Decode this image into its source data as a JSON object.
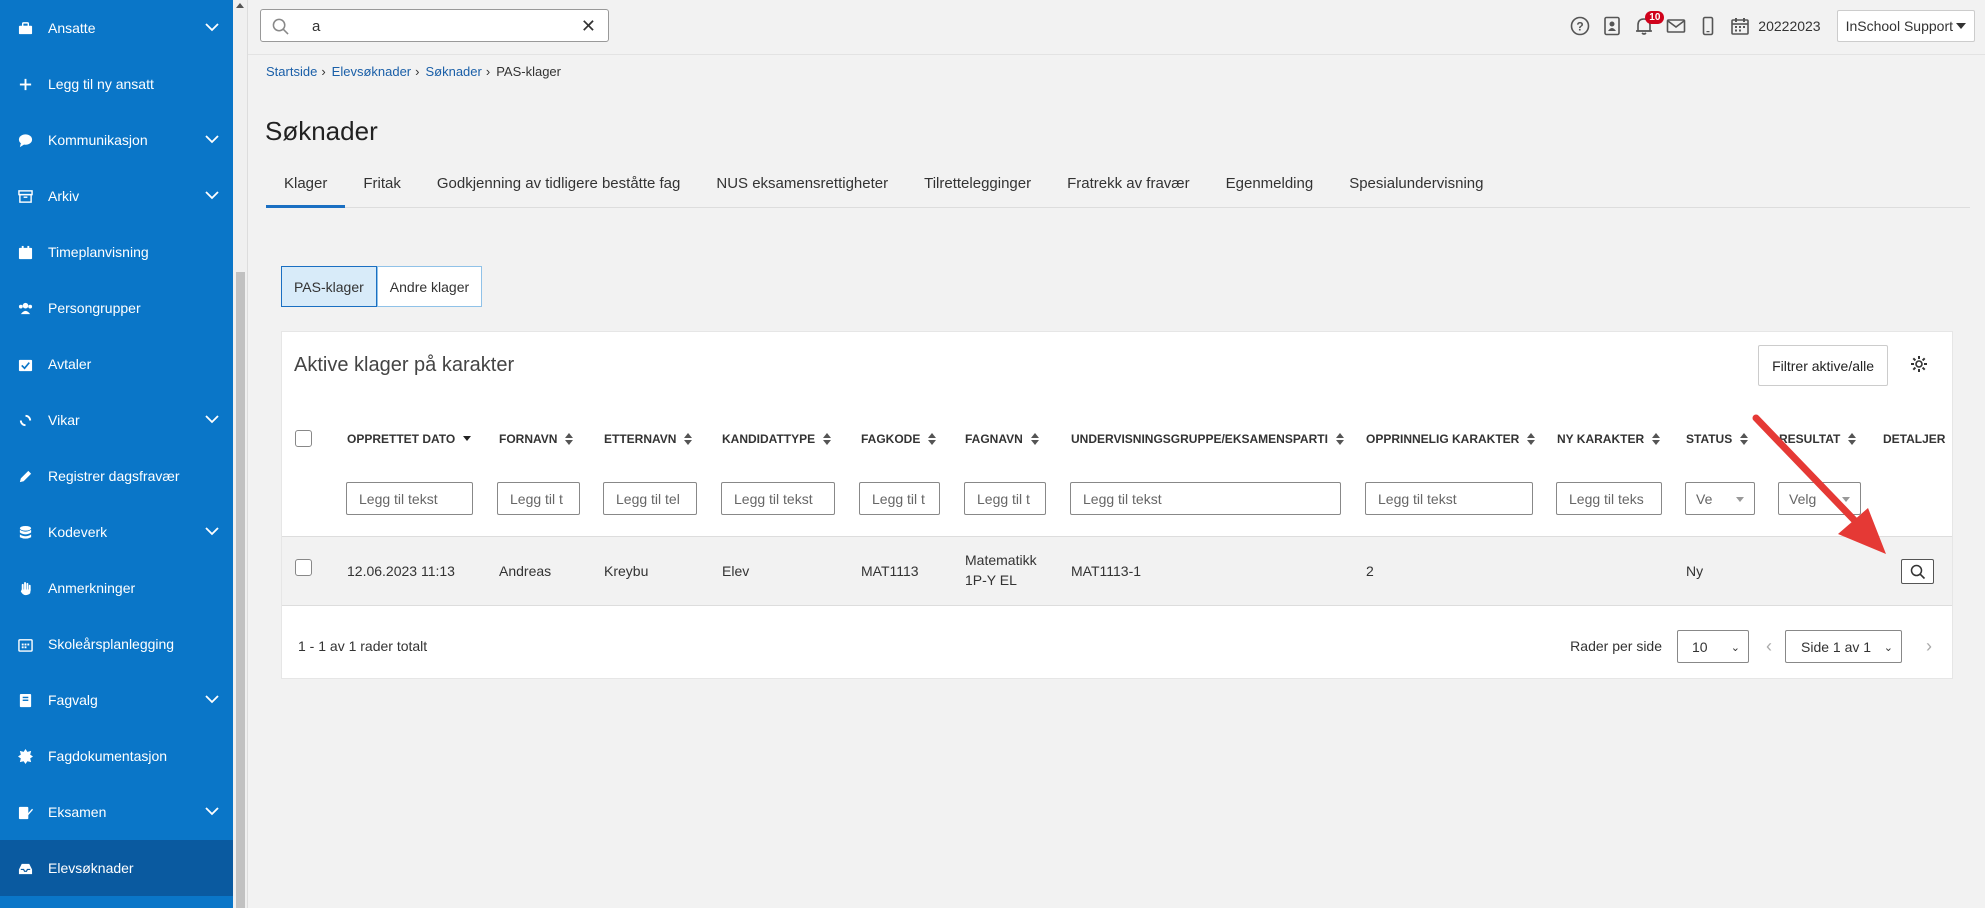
{
  "sidebar": {
    "items": [
      {
        "label": "Ansatte",
        "icon": "briefcase-icon",
        "has_children": true
      },
      {
        "label": "Legg til ny ansatt",
        "icon": "plus-icon",
        "has_children": false
      },
      {
        "label": "Kommunikasjon",
        "icon": "chat-bubble-icon",
        "has_children": true
      },
      {
        "label": "Arkiv",
        "icon": "archive-icon",
        "has_children": true
      },
      {
        "label": "Timeplanvisning",
        "icon": "calendar-icon",
        "has_children": false
      },
      {
        "label": "Persongrupper",
        "icon": "users-icon",
        "has_children": false
      },
      {
        "label": "Avtaler",
        "icon": "calendar-check-icon",
        "has_children": false
      },
      {
        "label": "Vikar",
        "icon": "sync-icon",
        "has_children": true
      },
      {
        "label": "Registrer dagsfravær",
        "icon": "pencil-icon",
        "has_children": false
      },
      {
        "label": "Kodeverk",
        "icon": "database-icon",
        "has_children": true
      },
      {
        "label": "Anmerkninger",
        "icon": "hand-icon",
        "has_children": false
      },
      {
        "label": "Skoleårsplanlegging",
        "icon": "calendar-grid-icon",
        "has_children": false
      },
      {
        "label": "Fagvalg",
        "icon": "book-icon",
        "has_children": true
      },
      {
        "label": "Fagdokumentasjon",
        "icon": "badge-icon",
        "has_children": false
      },
      {
        "label": "Eksamen",
        "icon": "exam-icon",
        "has_children": true
      },
      {
        "label": "Elevsøknader",
        "icon": "inbox-icon",
        "has_children": false,
        "active": true
      }
    ]
  },
  "topbar": {
    "search_value": "a",
    "notification_count": "10",
    "school_year": "20222023",
    "user_menu": "InSchool Support"
  },
  "breadcrumb": [
    "Startside",
    "Elevsøknader",
    "Søknader",
    "PAS-klager"
  ],
  "page_title": "Søknader",
  "tabs": [
    "Klager",
    "Fritak",
    "Godkjenning av tidligere beståtte fag",
    "NUS eksamensrettigheter",
    "Tilrettelegginger",
    "Fratrekk av fravær",
    "Egenmelding",
    "Spesialundervisning"
  ],
  "segments": [
    "PAS-klager",
    "Andre klager"
  ],
  "card": {
    "title": "Aktive klager på karakter",
    "filter_button": "Filtrer aktive/alle"
  },
  "table": {
    "columns": [
      "Opprettet dato",
      "Fornavn",
      "Etternavn",
      "Kandidattype",
      "Fagkode",
      "Fagnavn",
      "Undervisningsgruppe/eksamensparti",
      "Opprinnelig karakter",
      "Ny karakter",
      "Status",
      "Resultat",
      "Detaljer"
    ],
    "filters": {
      "text_placeholder": "Legg til tekst",
      "fornavn": "Legg til t",
      "etternavn": "Legg til tel",
      "fagkode": "Legg til t",
      "fagnavn": "Legg til t",
      "ny_karakter": "Legg til teks",
      "status": "Ve",
      "resultat": "Velg"
    },
    "rows": [
      {
        "opprettet": "12.06.2023 11:13",
        "fornavn": "Andreas",
        "etternavn": "Kreybu",
        "kandidattype": "Elev",
        "fagkode": "MAT1113",
        "fagnavn_line1": "Matematikk",
        "fagnavn_line2": "1P-Y EL",
        "gruppe": "MAT1113-1",
        "opprinnelig": "2",
        "ny": "",
        "status": "Ny",
        "resultat": ""
      }
    ]
  },
  "pagination": {
    "total": "1 - 1 av 1 rader totalt",
    "rows_label": "Rader per side",
    "rows_value": "10",
    "page_value": "Side 1 av 1"
  },
  "colors": {
    "sidebar": "#0a76c8",
    "sidebar_active": "#0a5aa0",
    "accent": "#1a6fc2",
    "arrow": "#e53935",
    "badge": "#d0021b"
  }
}
